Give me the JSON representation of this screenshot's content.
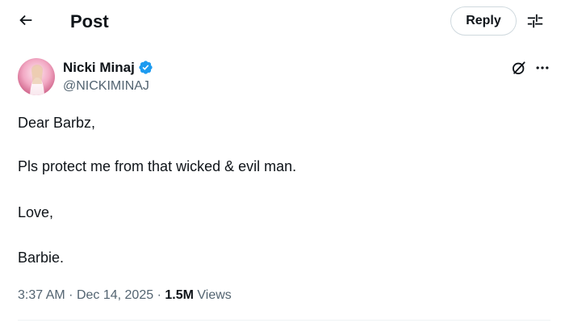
{
  "header": {
    "title": "Post",
    "reply_label": "Reply",
    "back_icon": "arrow-left-icon",
    "adjust_icon": "sliders-icon"
  },
  "author": {
    "display_name": "Nicki Minaj",
    "handle": "@NICKIMINAJ",
    "verified": true,
    "verified_color": "#1d9bf0"
  },
  "post": {
    "lines": [
      "Dear Barbz,",
      "Pls protect me from that wicked & evil man.",
      "Love,",
      "Barbie."
    ],
    "time": "3:37 AM",
    "date": "Dec 14, 2025",
    "views_count": "1.5M",
    "views_label": "Views"
  },
  "colors": {
    "text": "#0f1419",
    "secondary": "#536471",
    "border": "#cfd9de"
  }
}
